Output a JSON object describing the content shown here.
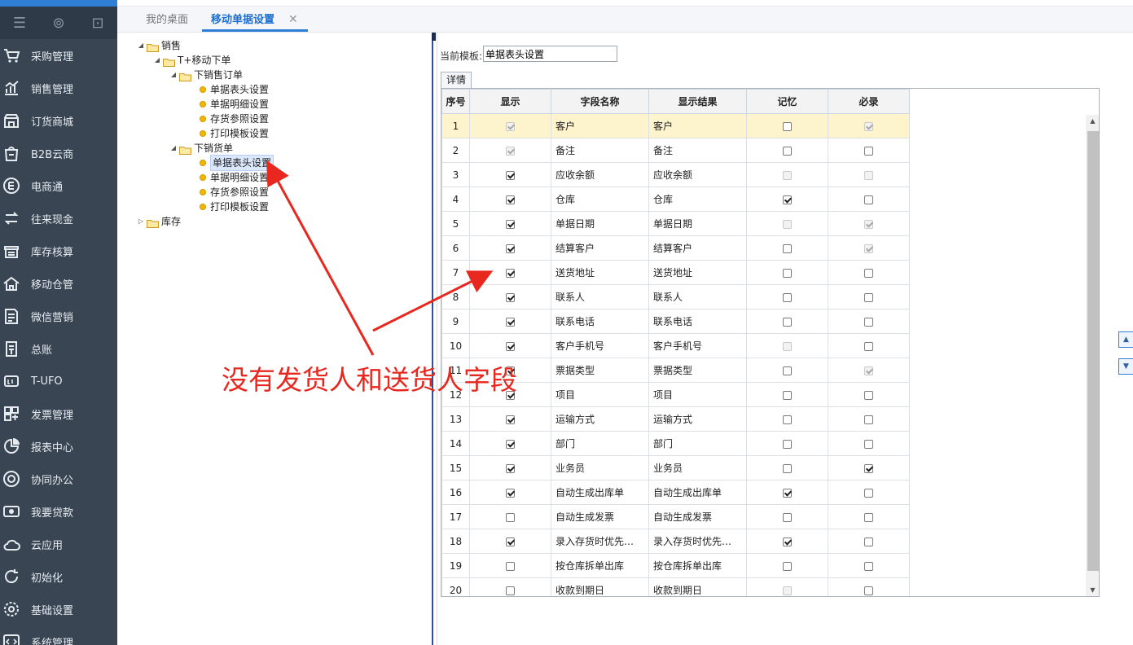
{
  "tabs": [
    {
      "label": "我的桌面"
    },
    {
      "label": "移动单据设置"
    }
  ],
  "sidebar": {
    "items": [
      {
        "label": "采购管理",
        "icon": "cart-icon"
      },
      {
        "label": "销售管理",
        "icon": "bar-chart-icon"
      },
      {
        "label": "订货商城",
        "icon": "store-icon"
      },
      {
        "label": "B2B云商",
        "icon": "bag-icon"
      },
      {
        "label": "电商通",
        "icon": "e-circle-icon"
      },
      {
        "label": "往来现金",
        "icon": "exchange-icon"
      },
      {
        "label": "库存核算",
        "icon": "warehouse-icon"
      },
      {
        "label": "移动仓管",
        "icon": "mobile-warehouse-icon"
      },
      {
        "label": "微信营销",
        "icon": "wechat-doc-icon"
      },
      {
        "label": "总账",
        "icon": "ledger-icon"
      },
      {
        "label": "T-UFO",
        "icon": "ufo-icon"
      },
      {
        "label": "发票管理",
        "icon": "grid-icon"
      },
      {
        "label": "报表中心",
        "icon": "pie-chart-icon"
      },
      {
        "label": "协同办公",
        "icon": "target-icon"
      },
      {
        "label": "我要贷款",
        "icon": "money-icon"
      },
      {
        "label": "云应用",
        "icon": "cloud-icon"
      },
      {
        "label": "初始化",
        "icon": "refresh-icon"
      },
      {
        "label": "基础设置",
        "icon": "settings-icon"
      },
      {
        "label": "系统管理",
        "icon": "code-icon"
      }
    ]
  },
  "tree": {
    "sales": "销售",
    "mobile_order": "T+移动下单",
    "sales_order": "下销售订单",
    "sales_order_items": [
      "单据表头设置",
      "单据明细设置",
      "存货参照设置",
      "打印模板设置"
    ],
    "sales_delivery": "下销货单",
    "sales_delivery_items": [
      "单据表头设置",
      "单据明细设置",
      "存货参照设置",
      "打印模板设置"
    ],
    "inventory": "库存"
  },
  "template": {
    "label": "当前模板:",
    "value": "单据表头设置"
  },
  "detail_tab": "详情",
  "grid": {
    "headers": [
      "序号",
      "显示",
      "字段名称",
      "显示结果",
      "记忆",
      "必录"
    ],
    "rows": [
      {
        "no": "1",
        "name": "客户",
        "result": "客户",
        "show": [
          1,
          1
        ],
        "memo": [
          0,
          0
        ],
        "req": [
          1,
          1
        ]
      },
      {
        "no": "2",
        "name": "备注",
        "result": "备注",
        "show": [
          1,
          1
        ],
        "memo": [
          0,
          0
        ],
        "req": [
          0,
          0
        ]
      },
      {
        "no": "3",
        "name": "应收余额",
        "result": "应收余额",
        "show": [
          1,
          0
        ],
        "memo": [
          0,
          1
        ],
        "req": [
          0,
          1
        ]
      },
      {
        "no": "4",
        "name": "仓库",
        "result": "仓库",
        "show": [
          1,
          0
        ],
        "memo": [
          1,
          0
        ],
        "req": [
          0,
          0
        ]
      },
      {
        "no": "5",
        "name": "单据日期",
        "result": "单据日期",
        "show": [
          1,
          0
        ],
        "memo": [
          0,
          1
        ],
        "req": [
          1,
          1
        ]
      },
      {
        "no": "6",
        "name": "结算客户",
        "result": "结算客户",
        "show": [
          1,
          0
        ],
        "memo": [
          0,
          0
        ],
        "req": [
          1,
          1
        ]
      },
      {
        "no": "7",
        "name": "送货地址",
        "result": "送货地址",
        "show": [
          1,
          0
        ],
        "memo": [
          0,
          0
        ],
        "req": [
          0,
          0
        ]
      },
      {
        "no": "8",
        "name": "联系人",
        "result": "联系人",
        "show": [
          1,
          0
        ],
        "memo": [
          0,
          0
        ],
        "req": [
          0,
          0
        ]
      },
      {
        "no": "9",
        "name": "联系电话",
        "result": "联系电话",
        "show": [
          1,
          0
        ],
        "memo": [
          0,
          0
        ],
        "req": [
          0,
          0
        ]
      },
      {
        "no": "10",
        "name": "客户手机号",
        "result": "客户手机号",
        "show": [
          1,
          0
        ],
        "memo": [
          0,
          1
        ],
        "req": [
          0,
          0
        ]
      },
      {
        "no": "11",
        "name": "票据类型",
        "result": "票据类型",
        "show": [
          1,
          0
        ],
        "memo": [
          0,
          0
        ],
        "req": [
          1,
          1
        ]
      },
      {
        "no": "12",
        "name": "项目",
        "result": "项目",
        "show": [
          1,
          0
        ],
        "memo": [
          0,
          0
        ],
        "req": [
          0,
          0
        ]
      },
      {
        "no": "13",
        "name": "运输方式",
        "result": "运输方式",
        "show": [
          1,
          0
        ],
        "memo": [
          0,
          0
        ],
        "req": [
          0,
          0
        ]
      },
      {
        "no": "14",
        "name": "部门",
        "result": "部门",
        "show": [
          1,
          0
        ],
        "memo": [
          0,
          0
        ],
        "req": [
          0,
          0
        ]
      },
      {
        "no": "15",
        "name": "业务员",
        "result": "业务员",
        "show": [
          1,
          0
        ],
        "memo": [
          0,
          0
        ],
        "req": [
          1,
          0
        ]
      },
      {
        "no": "16",
        "name": "自动生成出库单",
        "result": "自动生成出库单",
        "show": [
          1,
          0
        ],
        "memo": [
          1,
          0
        ],
        "req": [
          0,
          0
        ]
      },
      {
        "no": "17",
        "name": "自动生成发票",
        "result": "自动生成发票",
        "show": [
          0,
          0
        ],
        "memo": [
          0,
          0
        ],
        "req": [
          0,
          0
        ]
      },
      {
        "no": "18",
        "name": "录入存货时优先…",
        "result": "录入存货时优先…",
        "show": [
          1,
          0
        ],
        "memo": [
          1,
          0
        ],
        "req": [
          0,
          0
        ]
      },
      {
        "no": "19",
        "name": "按仓库拆单出库",
        "result": "按仓库拆单出库",
        "show": [
          0,
          0
        ],
        "memo": [
          0,
          0
        ],
        "req": [
          0,
          0
        ]
      },
      {
        "no": "20",
        "name": "收款到期日",
        "result": "收款到期日",
        "show": [
          0,
          0
        ],
        "memo": [
          0,
          1
        ],
        "req": [
          0,
          0
        ]
      }
    ]
  },
  "annotation": "没有发货人和送货人字段",
  "colors": {
    "sidebar": "#3a4554",
    "accent": "#2f7fd6",
    "annotation": "#e8271f",
    "highlight_row": "#fdf4cd"
  }
}
